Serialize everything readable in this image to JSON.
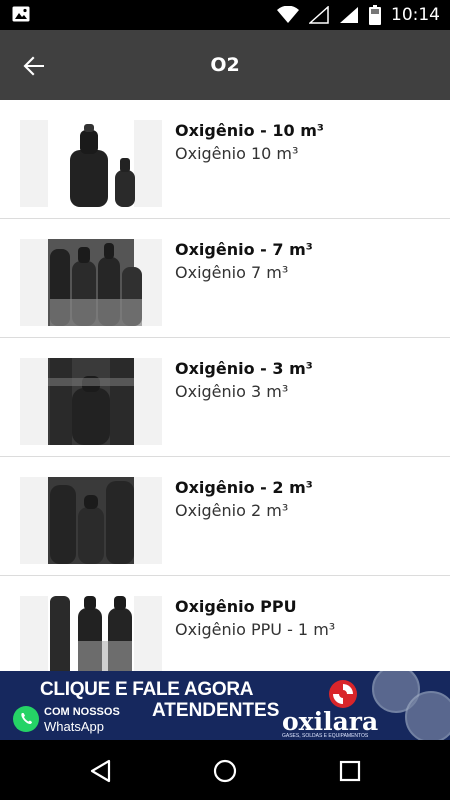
{
  "status_bar": {
    "time": "10:14"
  },
  "toolbar": {
    "title": "O2"
  },
  "products": [
    {
      "name": "Oxigênio - 10 m³",
      "description": "Oxigênio 10 m³"
    },
    {
      "name": "Oxigênio - 7 m³",
      "description": "Oxigênio 7 m³"
    },
    {
      "name": "Oxigênio - 3 m³",
      "description": "Oxigênio 3 m³"
    },
    {
      "name": "Oxigênio - 2 m³",
      "description": "Oxigênio 2 m³"
    },
    {
      "name": "Oxigênio PPU",
      "description": "Oxigênio PPU - 1 m³"
    }
  ],
  "banner": {
    "line1": "CLIQUE E FALE AGORA",
    "line2_small": "COM NOSSOS",
    "line2_big": "ATENDENTES",
    "whatsapp_label": "WhatsApp",
    "brand": "oxilara",
    "tagline": "GASES, SOLDAS E EQUIPAMENTOS"
  },
  "colors": {
    "toolbar": "#404040",
    "banner": "#16285e",
    "brand_red": "#d9252a",
    "whatsapp_green": "#25d366"
  },
  "icons": [
    "image-icon",
    "wifi-icon",
    "signal-icon",
    "battery-icon",
    "arrow-back-icon",
    "whatsapp-icon",
    "oxilara-logo-icon",
    "nav-back-icon",
    "nav-home-icon",
    "nav-recents-icon"
  ]
}
